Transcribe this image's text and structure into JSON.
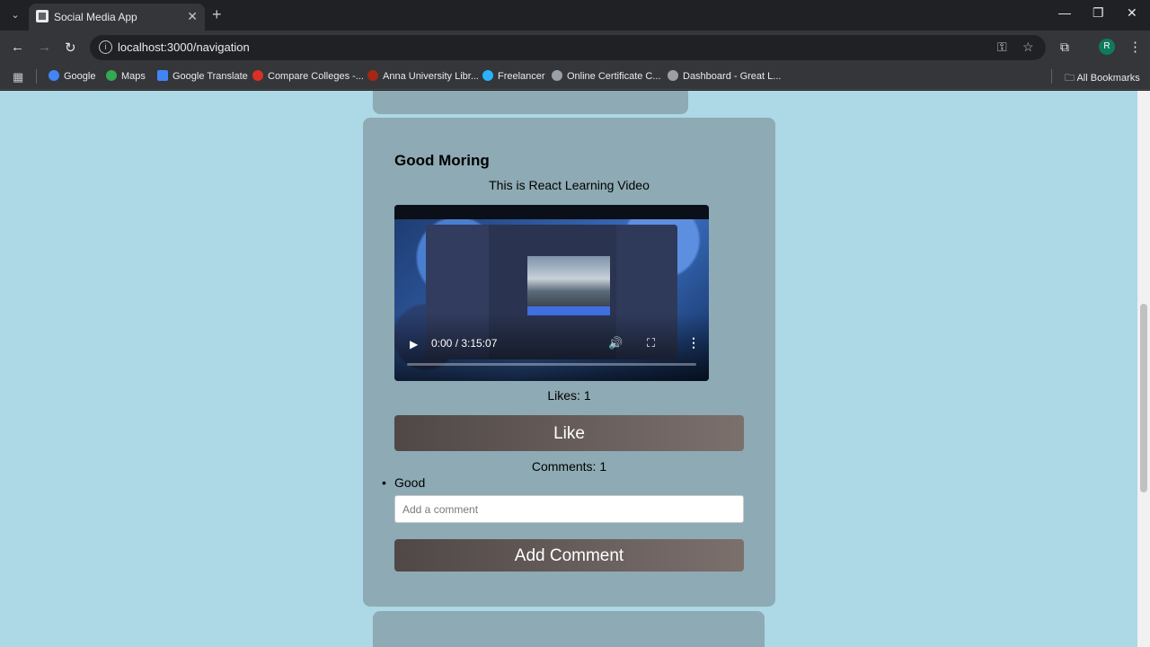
{
  "browser": {
    "tab_title": "Social Media App",
    "url": "localhost:3000/navigation",
    "profile_initial": "R",
    "bookmarks": [
      {
        "label": "Google",
        "color": "#4285f4"
      },
      {
        "label": "Maps",
        "color": "#34a853"
      },
      {
        "label": "Google Translate",
        "color": "#4285f4"
      },
      {
        "label": "Compare Colleges -...",
        "color": "#d93025"
      },
      {
        "label": "Anna University Libr...",
        "color": "#a52714"
      },
      {
        "label": "Freelancer",
        "color": "#29b2fe"
      },
      {
        "label": "Online Certificate C...",
        "color": "#9aa0a6"
      },
      {
        "label": "Dashboard - Great L...",
        "color": "#9aa0a6"
      }
    ],
    "all_bookmarks": "All Bookmarks"
  },
  "post": {
    "title": "Good Moring",
    "description": "This is React Learning Video",
    "video_time": "0:00 / 3:15:07",
    "likes_label": "Likes: 1",
    "like_button": "Like",
    "comments_label": "Comments: 1",
    "comments": [
      "Good"
    ],
    "comment_placeholder": "Add a comment",
    "add_comment_button": "Add Comment"
  },
  "colors": {
    "page_bg": "#add8e6",
    "card_bg": "#8eaab4"
  }
}
